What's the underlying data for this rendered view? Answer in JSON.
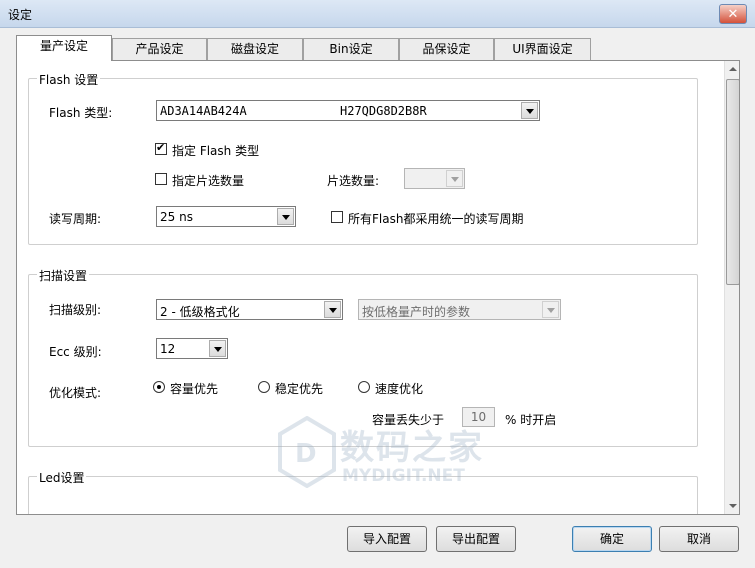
{
  "window": {
    "title": "设定",
    "close_glyph": "✕"
  },
  "tabs": [
    {
      "label": "量产设定",
      "active": true
    },
    {
      "label": "产品设定",
      "active": false
    },
    {
      "label": "磁盘设定",
      "active": false
    },
    {
      "label": "Bin设定",
      "active": false
    },
    {
      "label": "品保设定",
      "active": false
    },
    {
      "label": "UI界面设定",
      "active": false
    }
  ],
  "flash_group": {
    "title": "Flash 设置",
    "type_label": "Flash 类型:",
    "type_value_1": "AD3A14AB424A",
    "type_value_2": "H27QDG8D2B8R",
    "specify_type_label": "指定 Flash 类型",
    "specify_type_checked": true,
    "specify_cs_label": "指定片选数量",
    "specify_cs_checked": false,
    "cs_count_label": "片选数量:",
    "cs_count_value": "",
    "rw_cycle_label": "读写周期:",
    "rw_cycle_value": "25 ns",
    "unified_cycle_label": "所有Flash都采用统一的读写周期",
    "unified_cycle_checked": false
  },
  "scan_group": {
    "title": "扫描设置",
    "scan_level_label": "扫描级别:",
    "scan_level_value": "2 - 低级格式化",
    "scan_param_value": "按低格量产时的参数",
    "ecc_label": "Ecc 级别:",
    "ecc_value": "12",
    "opt_mode_label": "优化模式:",
    "opt_options": [
      {
        "label": "容量优先",
        "checked": true
      },
      {
        "label": "稳定优先",
        "checked": false
      },
      {
        "label": "速度优化",
        "checked": false
      }
    ],
    "capacity_loss_prefix": "容量丢失少于",
    "capacity_loss_value": "10",
    "capacity_loss_suffix": "% 时开启"
  },
  "led_group": {
    "title": "Led设置"
  },
  "buttons": {
    "import": "导入配置",
    "export": "导出配置",
    "ok": "确定",
    "cancel": "取消"
  },
  "watermark": {
    "cn": "数码之家",
    "en": "MYDIGIT.NET"
  }
}
